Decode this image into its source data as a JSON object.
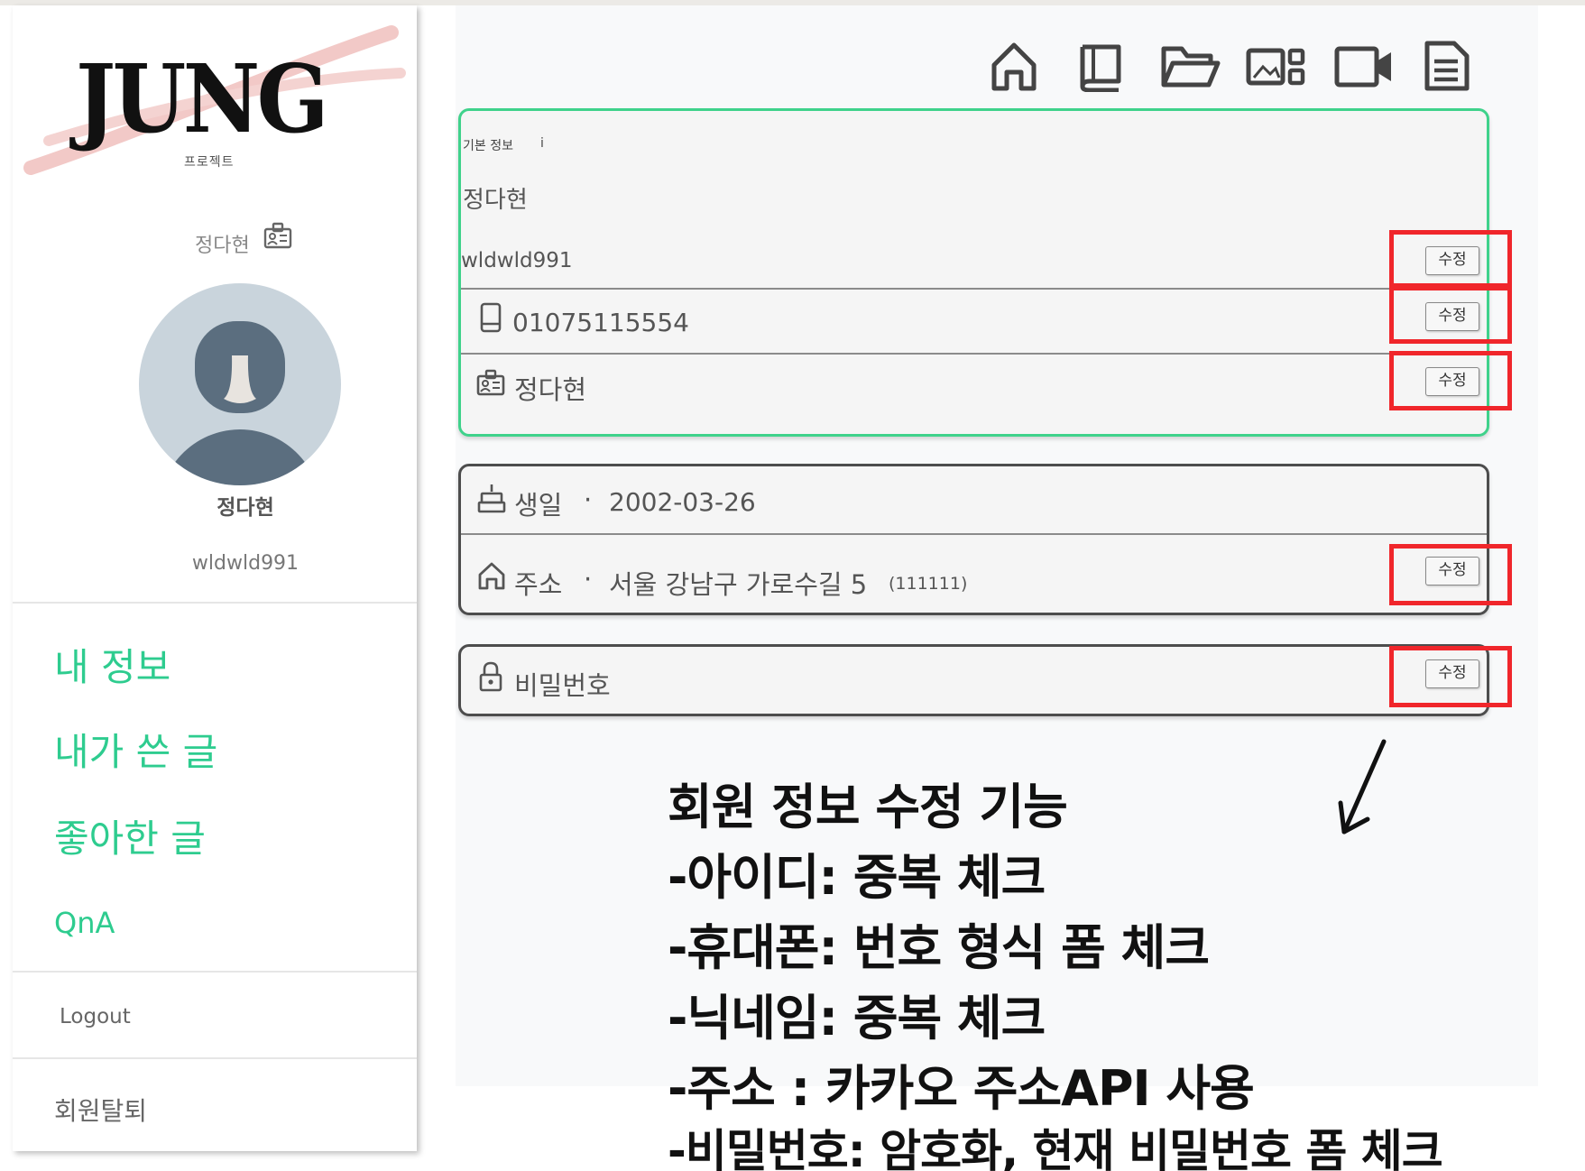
{
  "sidebar": {
    "logo": "JUNG",
    "logo_sub": "프로젝트",
    "nickname": "정다현",
    "profile_name": "정다현",
    "profile_id": "wldwld991",
    "menu": [
      {
        "label": "내 정보"
      },
      {
        "label": "내가 쓴 글"
      },
      {
        "label": "좋아한 글"
      },
      {
        "label": "QnA"
      }
    ],
    "logout": "Logout",
    "withdraw": "회원탈퇴"
  },
  "top_icons": [
    "home-icon",
    "book-icon",
    "folder-icon",
    "gallery-icon",
    "video-icon",
    "document-icon"
  ],
  "basic_info": {
    "title": "기본 정보",
    "info_mark": "i",
    "name": "정다현",
    "user_id": "wldwld991",
    "phone": "01075115554",
    "nickname": "정다현",
    "edit_label": "수정"
  },
  "extra_info": {
    "birthday_label": "생일",
    "birthday_value": "2002-03-26",
    "address_label": "주소",
    "address_value": "서울 강남구 가로수길 5",
    "address_zip": "(111111)",
    "separator": "·",
    "edit_label": "수정"
  },
  "password": {
    "label": "비밀번호",
    "edit_label": "수정"
  },
  "annotation": {
    "lines": [
      "회원 정보 수정 기능",
      "-아이디: 중복 체크",
      "-휴대폰: 번호 형식 폼 체크",
      "-닉네임: 중복 체크",
      "-주소 : 카카오 주소API 사용",
      "-비밀번호: 암호화, 현재 비밀번호 폼 체크"
    ],
    "highlight_color": "#f0262b",
    "accent_color": "#2ecc8f"
  }
}
